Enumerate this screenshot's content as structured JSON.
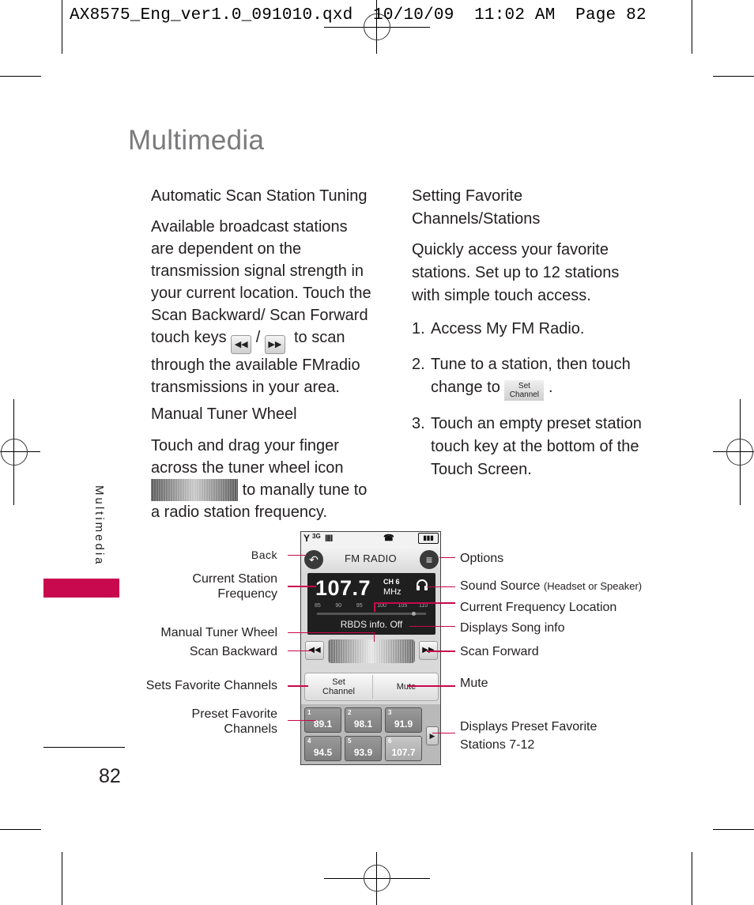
{
  "slug": {
    "filename": "AX8575_Eng_ver1.0_091010.qxd",
    "date": "10/10/09",
    "time": "11:02 AM",
    "page_label": "Page 82"
  },
  "page": {
    "title": "Multimedia",
    "side_tab": "Multimedia",
    "accent_color": "#c8094d",
    "page_number": "82"
  },
  "left_column": {
    "auto_scan": {
      "heading": "Automatic Scan Station Tuning",
      "text_before_keys": "Available broadcast stations are dependent on the transmission signal strength in your current location. Touch the Scan Backward/ Scan Forward touch keys",
      "separator": "/",
      "text_after_keys": "to scan through the available FMradio transmissions in your area.",
      "backward_key_icon": "scan-backward-icon",
      "forward_key_icon": "scan-forward-icon"
    },
    "manual_tuner": {
      "heading": "Manual Tuner Wheel",
      "text_before_icon": "Touch and drag your finger across the tuner wheel icon",
      "text_after_icon": "to manally tune to a radio station frequency."
    }
  },
  "right_column": {
    "heading_line1": "Setting Favorite",
    "heading_line2": "Channels/Stations",
    "intro": "Quickly access your favorite stations. Set up to 12 stations with simple touch access.",
    "steps": [
      {
        "num": "1.",
        "text": "Access My FM Radio."
      },
      {
        "num": "2.",
        "text_before_icon": "Tune to a station, then touch change to",
        "text_after_icon": "."
      },
      {
        "num": "3.",
        "text": "Touch an empty preset station touch key at the bottom of the Touch Screen."
      }
    ],
    "set_channel_icon_line1": "Set",
    "set_channel_icon_line2": "Channel"
  },
  "phone": {
    "status_icons": [
      "signal-icon",
      "3g-1x-icon",
      "signal-bars-icon",
      "tty-icon",
      "battery-icon"
    ],
    "status_text": {
      "signal": "Y",
      "network": "3G",
      "bars": "IIII",
      "battery": "▮▮▮"
    },
    "back_glyph": "↶",
    "options_glyph": "≡",
    "title": "FM RADIO",
    "frequency": "107.7",
    "channel": "CH 6",
    "unit": "MHz",
    "scale_labels": [
      "85",
      "90",
      "95",
      "100",
      "105",
      "110"
    ],
    "scale_range": [
      85,
      110
    ],
    "current_position_mhz": 107.7,
    "rbds": "RBDS info. Off",
    "scan_back_glyph": "◀◀",
    "scan_fwd_glyph": "▶▶",
    "set_channel_line1": "Set",
    "set_channel_line2": "Channel",
    "mute": "Mute",
    "presets": [
      {
        "n": "1",
        "freq": "89.1",
        "active": false
      },
      {
        "n": "2",
        "freq": "98.1",
        "active": false
      },
      {
        "n": "3",
        "freq": "91.9",
        "active": false
      },
      {
        "n": "4",
        "freq": "94.5",
        "active": false
      },
      {
        "n": "5",
        "freq": "93.9",
        "active": false
      },
      {
        "n": "6",
        "freq": "107.7",
        "active": true
      }
    ],
    "more_glyph": "▶"
  },
  "callouts": {
    "left": {
      "back": "Back",
      "current_station_1": "Current Station",
      "current_station_2": "Frequency",
      "manual_tuner": "Manual Tuner Wheel",
      "scan_backward": "Scan Backward",
      "sets_favorite": "Sets Favorite Channels",
      "preset_1": "Preset Favorite",
      "preset_2": "Channels"
    },
    "right": {
      "options": "Options",
      "sound_source": "Sound Source",
      "sound_source_note": "(Headset or Speaker)",
      "current_freq_location": "Current Frequency Location",
      "song_info": "Displays Song info",
      "scan_forward": "Scan Forward",
      "mute": "Mute",
      "displays_preset_1": "Displays Preset Favorite",
      "displays_preset_2": "Stations 7-12"
    }
  }
}
